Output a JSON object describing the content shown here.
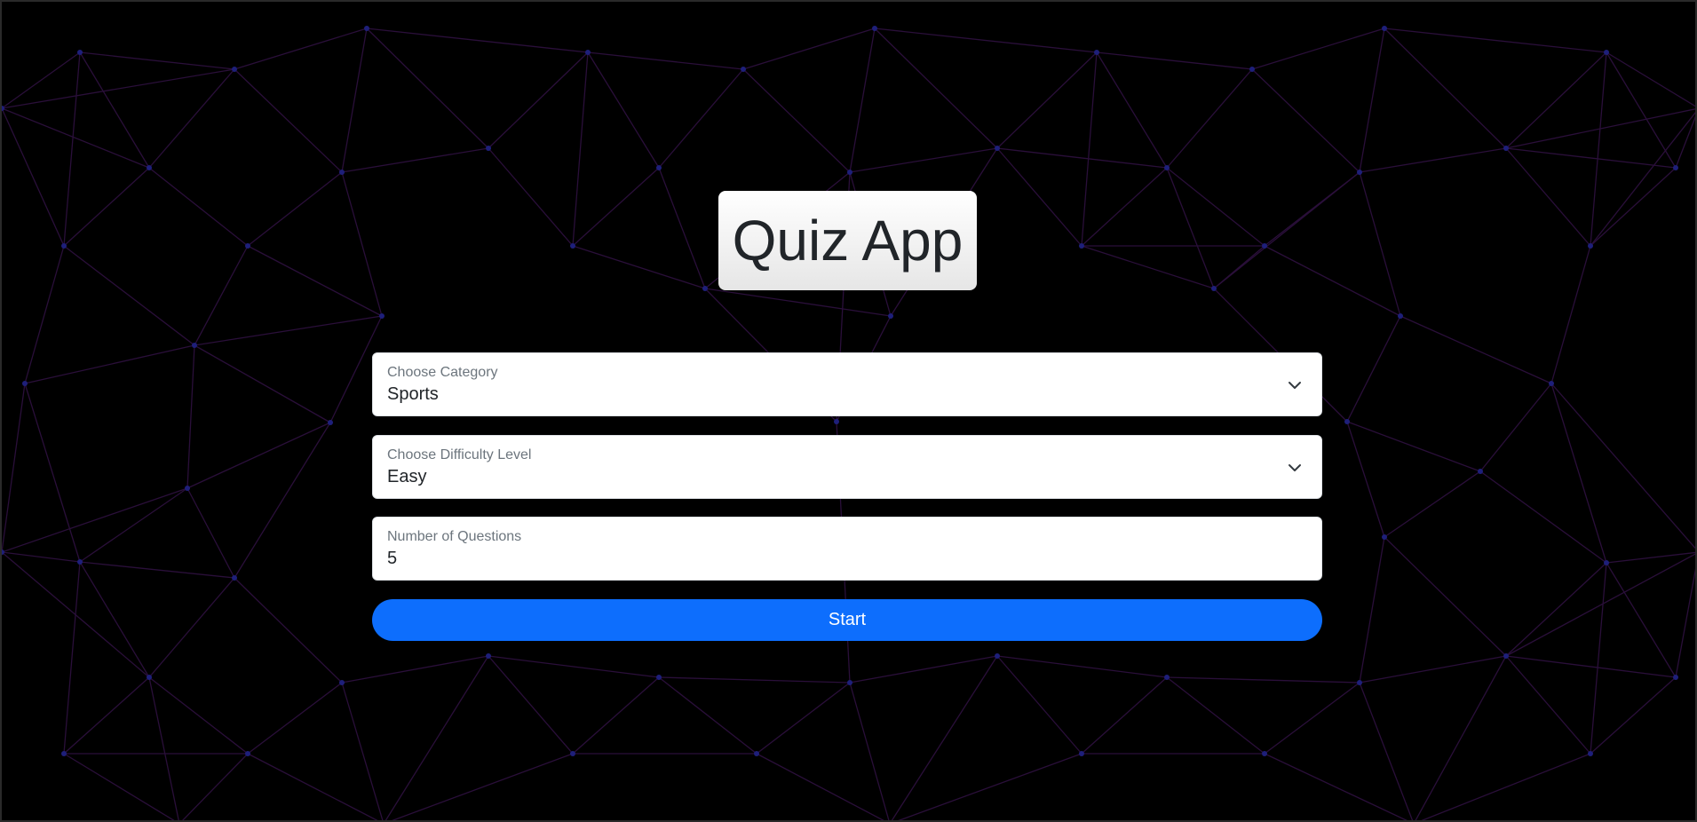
{
  "app": {
    "title": "Quiz App"
  },
  "form": {
    "category": {
      "label": "Choose Category",
      "value": "Sports",
      "icon": "chevron-down-icon"
    },
    "difficulty": {
      "label": "Choose Difficulty Level",
      "value": "Easy",
      "icon": "chevron-down-icon"
    },
    "questions": {
      "label": "Number of Questions",
      "value": "5"
    },
    "start_label": "Start"
  },
  "colors": {
    "background": "#000000",
    "mesh_line": "#2a0f3a",
    "mesh_node": "#1e1f7a",
    "primary": "#0d6efd",
    "card": "#ffffff"
  }
}
